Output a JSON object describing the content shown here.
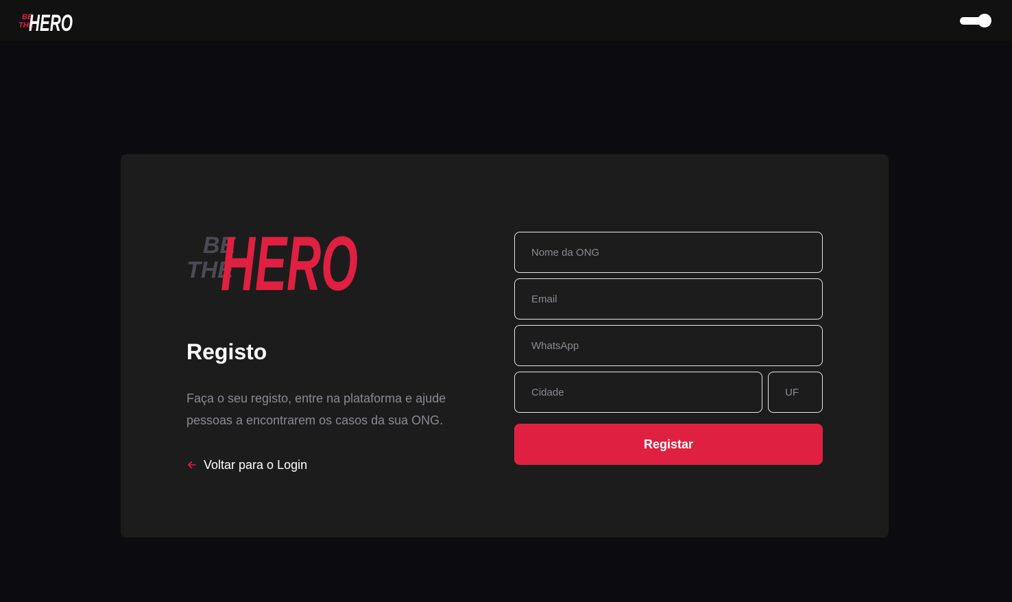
{
  "header": {
    "logo_text": "BE THE HERO",
    "theme_toggle": "theme-toggle"
  },
  "brand": {
    "logo_text": "BE THE HERO",
    "accent": "#e02041",
    "muted": "#4b4a55"
  },
  "register": {
    "title": "Registo",
    "description": "Faça o seu registo, entre na plataforma e ajude pessoas a encontrarem os casos da sua ONG.",
    "back_link_label": "Voltar para o Login",
    "back_icon": "arrow-left-icon"
  },
  "form": {
    "name_placeholder": "Nome da ONG",
    "email_placeholder": "Email",
    "whatsapp_placeholder": "WhatsApp",
    "city_placeholder": "Cidade",
    "uf_placeholder": "UF",
    "submit_label": "Registar"
  }
}
